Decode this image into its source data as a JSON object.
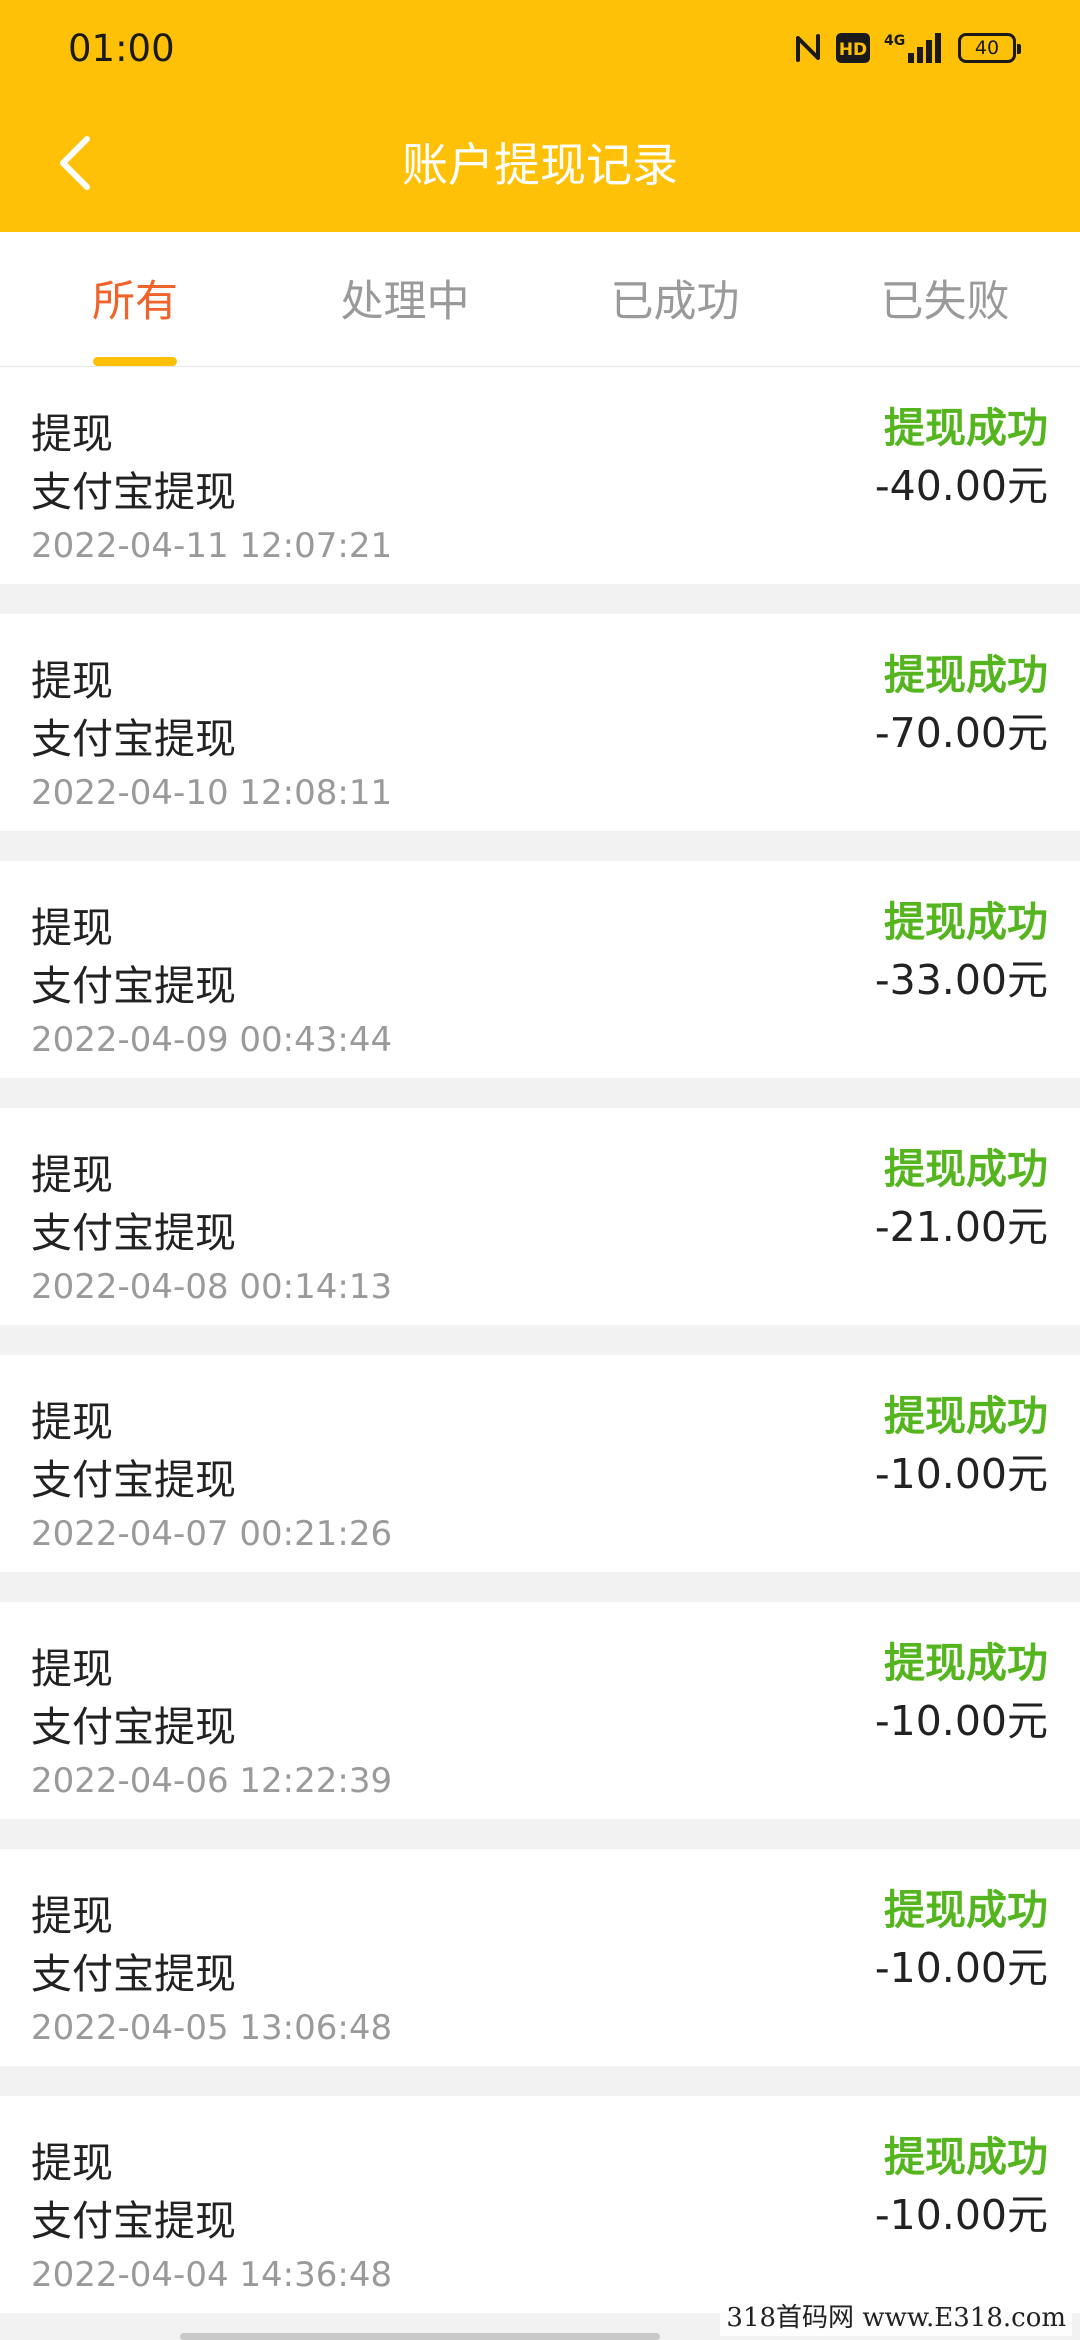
{
  "status_bar": {
    "time": "01:00",
    "hd_label": "HD",
    "network_label": "4G",
    "battery_level": "40"
  },
  "header": {
    "title": "账户提现记录",
    "back_icon": "chevron-left-icon",
    "background_color": "#FFC107"
  },
  "tabs": [
    {
      "label": "所有",
      "active": true
    },
    {
      "label": "处理中",
      "active": false
    },
    {
      "label": "已成功",
      "active": false
    },
    {
      "label": "已失败",
      "active": false
    }
  ],
  "colors": {
    "tab_active": "#F0632A",
    "tab_inactive": "#9a9a9a",
    "status_success": "#55B51E"
  },
  "records": [
    {
      "type": "提现",
      "method": "支付宝提现",
      "time": "2022-04-11 12:07:21",
      "status": "提现成功",
      "amount": "-40.00元"
    },
    {
      "type": "提现",
      "method": "支付宝提现",
      "time": "2022-04-10 12:08:11",
      "status": "提现成功",
      "amount": "-70.00元"
    },
    {
      "type": "提现",
      "method": "支付宝提现",
      "time": "2022-04-09 00:43:44",
      "status": "提现成功",
      "amount": "-33.00元"
    },
    {
      "type": "提现",
      "method": "支付宝提现",
      "time": "2022-04-08 00:14:13",
      "status": "提现成功",
      "amount": "-21.00元"
    },
    {
      "type": "提现",
      "method": "支付宝提现",
      "time": "2022-04-07 00:21:26",
      "status": "提现成功",
      "amount": "-10.00元"
    },
    {
      "type": "提现",
      "method": "支付宝提现",
      "time": "2022-04-06 12:22:39",
      "status": "提现成功",
      "amount": "-10.00元"
    },
    {
      "type": "提现",
      "method": "支付宝提现",
      "time": "2022-04-05 13:06:48",
      "status": "提现成功",
      "amount": "-10.00元"
    },
    {
      "type": "提现",
      "method": "支付宝提现",
      "time": "2022-04-04 14:36:48",
      "status": "提现成功",
      "amount": "-10.00元"
    }
  ],
  "watermark": "318首码网 www.E318.com"
}
